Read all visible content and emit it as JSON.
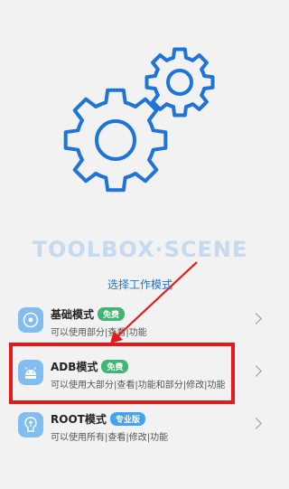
{
  "brand": "TOOLBOX·SCENE",
  "subtitle": "选择工作模式",
  "colors": {
    "accent": "#1e74d8",
    "highlight": "#e61919",
    "free_badge": "#3fb772",
    "pro_badge": "#42a3ee"
  },
  "options": [
    {
      "title": "基础模式",
      "badge": "免费",
      "desc": "可以使用部分|查看|功能",
      "icon": "disc-icon"
    },
    {
      "title": "ADB模式",
      "badge": "免费",
      "desc": "可以使用大部分|查看|功能和部分|修改|功能",
      "icon": "android-icon"
    },
    {
      "title": "ROOT模式",
      "badge": "专业版",
      "desc": "可以使用所有|查看|修改|功能",
      "icon": "root-icon"
    }
  ]
}
